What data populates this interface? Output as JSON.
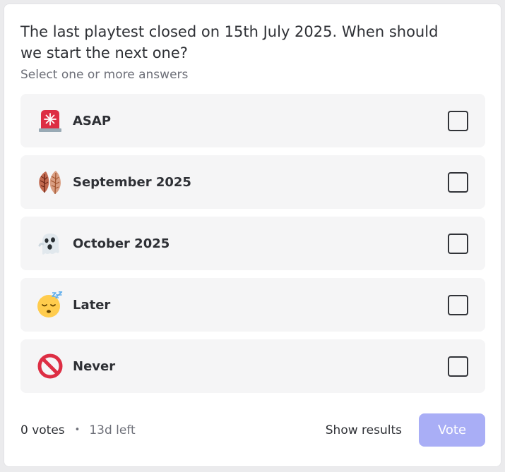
{
  "poll": {
    "question": "The last playtest closed on 15th July 2025. When should we start the next one?",
    "subtitle": "Select one or more answers",
    "answers": [
      {
        "label": "ASAP",
        "icon": "police-siren-icon",
        "checked": false
      },
      {
        "label": "September 2025",
        "icon": "fallen-leaves-icon",
        "checked": false
      },
      {
        "label": "October 2025",
        "icon": "ghost-icon",
        "checked": false
      },
      {
        "label": "Later",
        "icon": "sleeping-face-icon",
        "checked": false
      },
      {
        "label": "Never",
        "icon": "prohibited-icon",
        "checked": false
      }
    ]
  },
  "footer": {
    "votes": "0 votes",
    "separator": "•",
    "time_left": "13d left",
    "show_results": "Show results",
    "vote_button": "Vote"
  },
  "colors": {
    "vote_button_disabled": "#a9aef6",
    "answer_background": "#f5f5f6",
    "text": "#2e3035",
    "muted_text": "#6d6f78"
  }
}
